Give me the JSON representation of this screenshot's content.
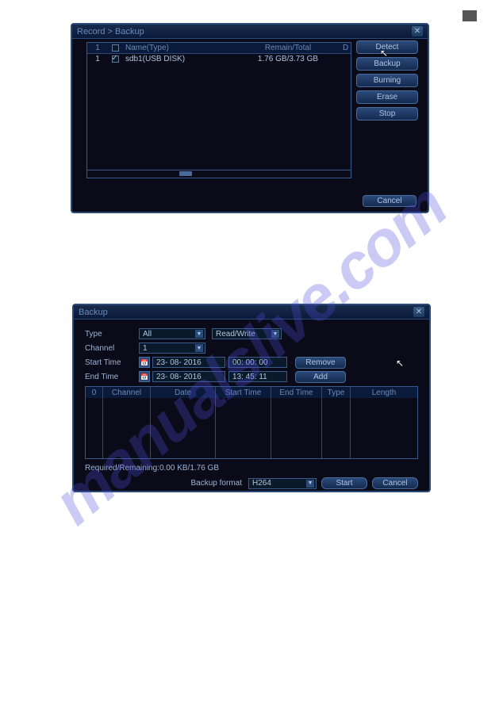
{
  "watermark": "manualslive.com",
  "window1": {
    "title": "Record > Backup",
    "columns": {
      "idx": "1",
      "name": "Name(Type)",
      "remain": "Remain/Total",
      "d": "D"
    },
    "row": {
      "idx": "1",
      "name": "sdb1(USB DISK)",
      "remain": "1.76 GB/3.73 GB"
    },
    "buttons": {
      "detect": "Detect",
      "backup": "Backup",
      "burning": "Burning",
      "erase": "Erase",
      "stop": "Stop",
      "cancel": "Cancel"
    }
  },
  "window2": {
    "title": "Backup",
    "labels": {
      "type": "Type",
      "channel": "Channel",
      "starttime": "Start Time",
      "endtime": "End Time",
      "backup_format": "Backup format",
      "status_prefix": "Required/Remaining:",
      "status_value": "0.00 KB/1.76 GB"
    },
    "values": {
      "type": "All",
      "mode": "Read/Write",
      "channel": "1",
      "start_date": "23- 08- 2016",
      "start_time": "00: 00: 00",
      "end_date": "23- 08- 2016",
      "end_time": "13: 45: 11",
      "format": "H264"
    },
    "buttons": {
      "remove": "Remove",
      "add": "Add",
      "start": "Start",
      "cancel": "Cancel"
    },
    "columns": {
      "zero": "0",
      "channel": "Channel",
      "date": "Date",
      "starttime": "Start Time",
      "endtime": "End Time",
      "type": "Type",
      "length": "Length"
    }
  }
}
